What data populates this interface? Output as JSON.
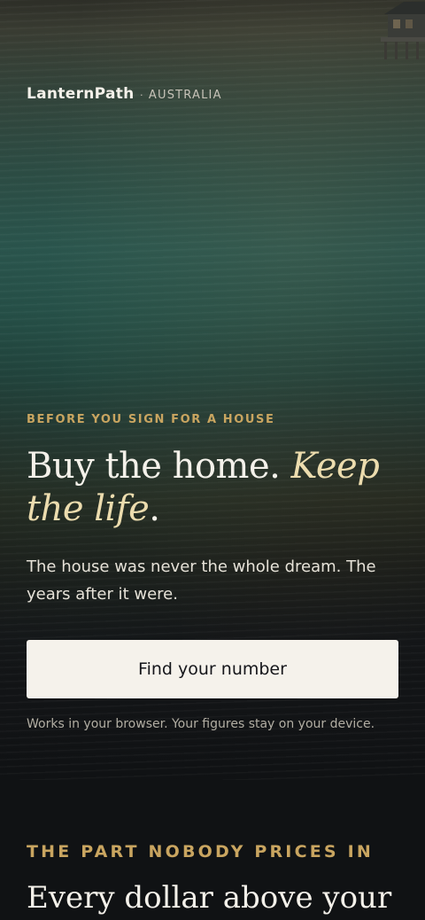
{
  "brand": {
    "name": "LanternPath",
    "separator": "·",
    "region": "AUSTRALIA"
  },
  "hero": {
    "eyebrow": "BEFORE YOU SIGN FOR A HOUSE",
    "headline_plain": "Buy the home. ",
    "headline_emphasis": "Keep the life",
    "headline_end": ".",
    "subhead": "The house was never the whole dream. The years after it were.",
    "cta_label": "Find your number",
    "note": "Works in your browser. Your figures stay on your device."
  },
  "section": {
    "eyebrow": "THE PART NOBODY PRICES IN",
    "title": "Every dollar above your"
  },
  "colors": {
    "accent_gold": "#c9a560",
    "cta_background": "#f5f2eb",
    "page_background": "#101214"
  }
}
